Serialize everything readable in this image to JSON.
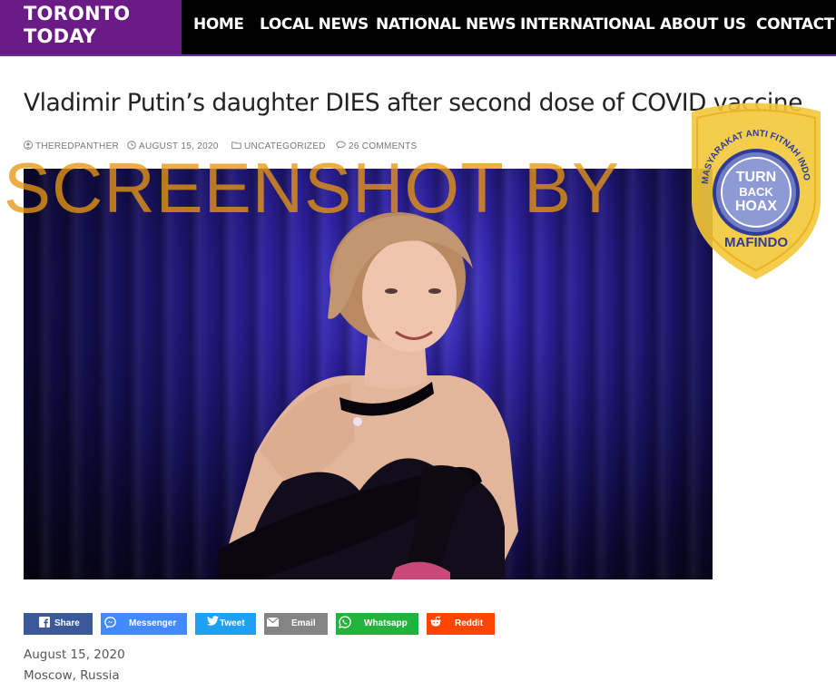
{
  "site": {
    "logo_line1": "TORONTO",
    "logo_line2": "TODAY"
  },
  "nav": {
    "items": [
      {
        "label": "HOME"
      },
      {
        "label": "LOCAL NEWS"
      },
      {
        "label": "NATIONAL NEWS"
      },
      {
        "label": "INTERNATIONAL"
      },
      {
        "label": "ABOUT US"
      },
      {
        "label": "CONTACT"
      }
    ]
  },
  "article": {
    "title": "Vladimir Putin’s daughter DIES after second dose of COVID vaccine",
    "meta": {
      "author": "THEREDPANTHER",
      "date": "AUGUST 15, 2020",
      "category": "UNCATEGORIZED",
      "comments": "26 COMMENTS"
    },
    "dateline": "August 15, 2020",
    "location": "Moscow, Russia"
  },
  "watermark": {
    "text": "SCREENSHOT BY",
    "badge_top": "MASYARAKAT ANTI FITNAH INDONESIA",
    "badge_line1": "TURN",
    "badge_line2": "BACK",
    "badge_line3": "HOAX",
    "badge_bottom": "MAFINDO"
  },
  "share": {
    "buttons": [
      {
        "label": "Share",
        "icon": "facebook-icon",
        "color": "#3b5998"
      },
      {
        "label": "Messenger",
        "icon": "messenger-icon",
        "color": "#448aff"
      },
      {
        "label": "Tweet",
        "icon": "twitter-icon",
        "color": "#1da1f2"
      },
      {
        "label": "Email",
        "icon": "email-icon",
        "color": "#848484"
      },
      {
        "label": "Whatsapp",
        "icon": "whatsapp-icon",
        "color": "#22b33c"
      },
      {
        "label": "Reddit",
        "icon": "reddit-icon",
        "color": "#ff4500"
      }
    ]
  },
  "colors": {
    "brand_purple": "#6b1b86",
    "header_bg": "#000000",
    "watermark_orange": "#e89612",
    "badge_yellow": "#f3c83a",
    "badge_blue": "#2f3c97"
  }
}
